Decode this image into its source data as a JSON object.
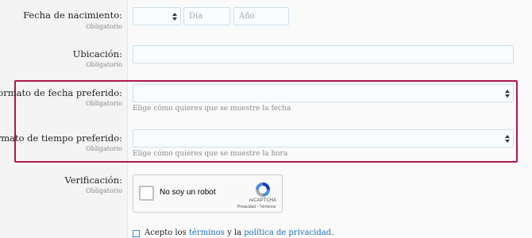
{
  "birthdate": {
    "label": "Fecha de nacimiento:",
    "required": "Obligatorio",
    "day_placeholder": "Día",
    "year_placeholder": "Año"
  },
  "location": {
    "label": "Ubicación:",
    "required": "Obligatorio"
  },
  "date_format": {
    "label": "Formato de fecha preferido:",
    "required": "Obligatorio",
    "hint": "Elige cómo quieres que se muestre la fecha"
  },
  "time_format": {
    "label": "Formato de tiempo preferido:",
    "required": "Obligatorio",
    "hint": "Elige cómo quieres que se muestre la hora"
  },
  "verification": {
    "label": "Verificación:",
    "required": "Obligatorio",
    "captcha_label": "No soy un robot",
    "captcha_brand": "reCAPTCHA",
    "captcha_privacy": "Privacidad",
    "captcha_sep": " - ",
    "captcha_terms": "Términos"
  },
  "agreement": {
    "prefix": "Acepto los ",
    "terms_link": "términos",
    "middle": " y la ",
    "privacy_link": "política de privacidad",
    "suffix": "."
  },
  "colors": {
    "highlight": "#b0184a",
    "link": "#1c6fb7"
  }
}
